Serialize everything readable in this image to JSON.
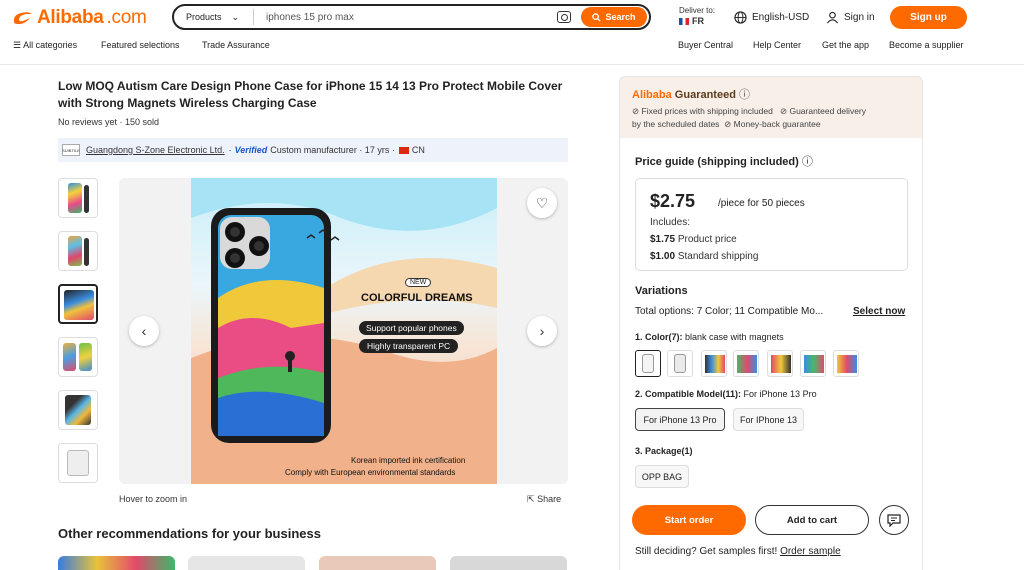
{
  "header": {
    "logo_text": "Alibaba",
    "logo_suffix": ".com",
    "search_category": "Products",
    "search_query": "iphones 15 pro max",
    "search_button": "Search",
    "deliver_label": "Deliver to:",
    "deliver_country": "FR",
    "language": "English-USD",
    "sign_in": "Sign in",
    "sign_up": "Sign up",
    "accent": "#ff6a00"
  },
  "nav": {
    "all_categories": "All categories",
    "featured": "Featured selections",
    "trade_assurance": "Trade Assurance",
    "buyer_central": "Buyer Central",
    "help_center": "Help Center",
    "get_app": "Get the app",
    "become_supplier": "Become a supplier"
  },
  "product": {
    "title": "Low MOQ Autism Care Design Phone Case for iPhone 15 14 13 Pro Protect Mobile Cover with Strong Magnets Wireless Charging Case",
    "reviews": "No reviews yet · 150 sold",
    "supplier_logo_text": "SUIBTILE",
    "supplier_name": "Guangdong S-Zone Electronic Ltd.",
    "verified": "Verified",
    "supplier_type": "Custom manufacturer · 17 yrs ·",
    "supplier_country": "CN"
  },
  "gallery": {
    "badge": "NEW",
    "headline": "COLORFUL DREAMS",
    "tag1": "Support popular phones",
    "tag2": "Highly transparent PC",
    "foot1": "Korean imported ink certification",
    "foot2": "Comply with European environmental standards",
    "hover_hint": "Hover to zoom in",
    "share": "Share"
  },
  "recommendations": {
    "title": "Other recommendations for your business"
  },
  "guarantee": {
    "brand": "Alibaba",
    "label": "Guaranteed",
    "item1": "Fixed prices with shipping included",
    "item2": "Guaranteed delivery",
    "item2b": "by the scheduled dates",
    "item3": "Money-back guarantee"
  },
  "price": {
    "guide_title": "Price guide (shipping included)",
    "amount": "$2.75",
    "per": "/piece for 50 pieces",
    "includes": "Includes:",
    "product_price_value": "$1.75",
    "product_price_label": "Product price",
    "shipping_value": "$1.00",
    "shipping_label": "Standard shipping"
  },
  "variations": {
    "title": "Variations",
    "total": "Total options: 7 Color; 11 Compatible Mo...",
    "select_now": "Select now",
    "color_label": "1. Color(7):",
    "color_value": "blank case with magnets",
    "model_label": "2. Compatible Model(11):",
    "model_value": "For iPhone 13 Pro",
    "models": [
      "For iPhone 13 Pro",
      "For IPhone 13"
    ],
    "package_label": "3. Package(1)",
    "packages": [
      "OPP BAG"
    ]
  },
  "actions": {
    "start_order": "Start order",
    "add_to_cart": "Add to cart",
    "still_deciding": "Still deciding? Get samples first!",
    "order_sample": "Order sample"
  }
}
